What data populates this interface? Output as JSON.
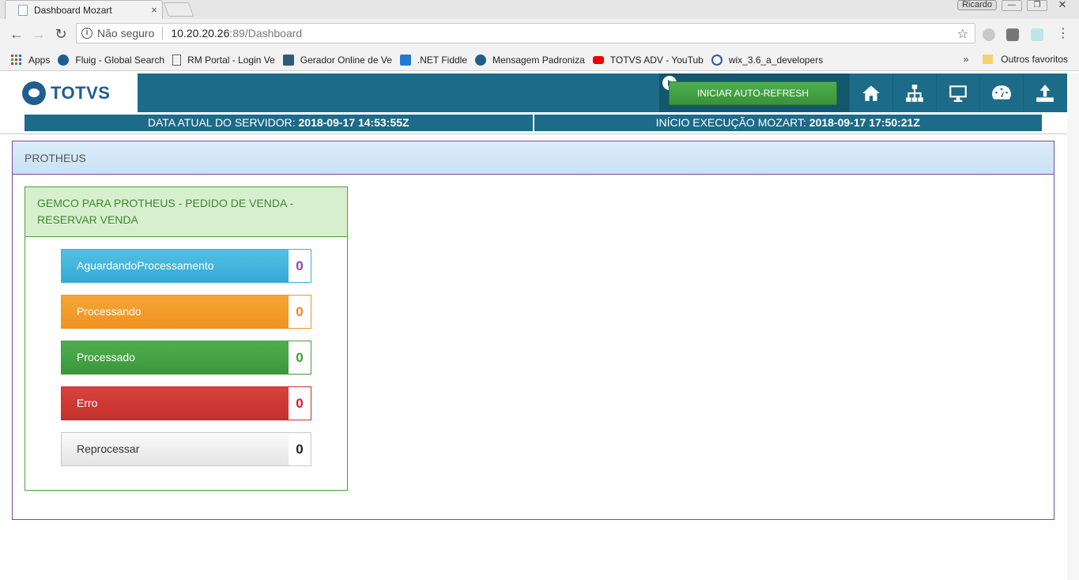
{
  "browser": {
    "tab_title": "Dashboard Mozart",
    "tab_close": "×",
    "user_badge": "Ricardo",
    "window_controls": [
      "—",
      "❐",
      "✕"
    ],
    "security_label": "Não seguro",
    "url_host": "10.20.20.26",
    "url_rest": ":89/Dashboard",
    "bookmarks": [
      {
        "label": "Apps",
        "icon": "apps-grid-icon"
      },
      {
        "label": "Fluig - Global Search",
        "icon": "fluig-icon"
      },
      {
        "label": "RM Portal - Login Ve",
        "icon": "page-icon"
      },
      {
        "label": "Gerador Online de Ve",
        "icon": "generator-icon"
      },
      {
        "label": ".NET Fiddle",
        "icon": "dotnet-icon"
      },
      {
        "label": "Mensagem Padroniza",
        "icon": "message-icon"
      },
      {
        "label": "TOTVS ADV - YouTub",
        "icon": "youtube-icon"
      },
      {
        "label": "wix_3.6_a_developers",
        "icon": "wix-icon"
      }
    ],
    "bookmarks_overflow": "»",
    "other_bookmarks": "Outros favoritos"
  },
  "header": {
    "logo_text": "TOTVS",
    "refresh_button": "INICIAR AUTO-REFRESH",
    "nav_icons": [
      "home-icon",
      "sitemap-icon",
      "monitor-icon",
      "dashboard-gauge-icon",
      "upload-icon"
    ]
  },
  "info": {
    "server_label": "DATA ATUAL DO SERVIDOR: ",
    "server_value": "2018-09-17 14:53:55Z",
    "start_label": "INÍCIO EXECUÇÃO MOZART: ",
    "start_value": "2018-09-17 17:50:21Z"
  },
  "panel": {
    "title": "PROTHEUS",
    "card": {
      "title": "GEMCO PARA PROTHEUS - PEDIDO DE VENDA - RESERVAR VENDA",
      "statuses": [
        {
          "label": "AguardandoProcessamento",
          "count": "0"
        },
        {
          "label": "Processando",
          "count": "0"
        },
        {
          "label": "Processado",
          "count": "0"
        },
        {
          "label": "Erro",
          "count": "0"
        },
        {
          "label": "Reprocessar",
          "count": "0"
        }
      ]
    }
  }
}
